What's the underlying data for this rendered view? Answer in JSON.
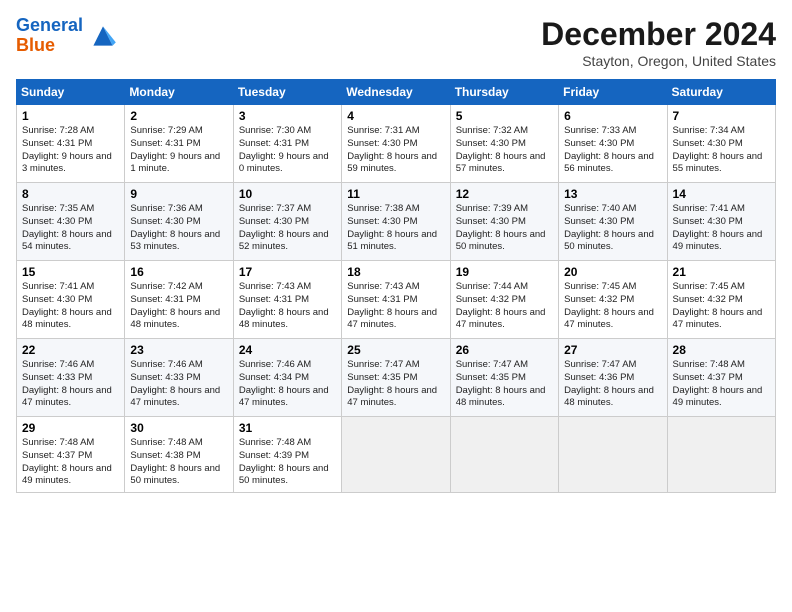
{
  "header": {
    "logo_line1": "General",
    "logo_line2": "Blue",
    "month": "December 2024",
    "location": "Stayton, Oregon, United States"
  },
  "weekdays": [
    "Sunday",
    "Monday",
    "Tuesday",
    "Wednesday",
    "Thursday",
    "Friday",
    "Saturday"
  ],
  "weeks": [
    [
      {
        "day": "1",
        "sunrise": "Sunrise: 7:28 AM",
        "sunset": "Sunset: 4:31 PM",
        "daylight": "Daylight: 9 hours and 3 minutes."
      },
      {
        "day": "2",
        "sunrise": "Sunrise: 7:29 AM",
        "sunset": "Sunset: 4:31 PM",
        "daylight": "Daylight: 9 hours and 1 minute."
      },
      {
        "day": "3",
        "sunrise": "Sunrise: 7:30 AM",
        "sunset": "Sunset: 4:31 PM",
        "daylight": "Daylight: 9 hours and 0 minutes."
      },
      {
        "day": "4",
        "sunrise": "Sunrise: 7:31 AM",
        "sunset": "Sunset: 4:30 PM",
        "daylight": "Daylight: 8 hours and 59 minutes."
      },
      {
        "day": "5",
        "sunrise": "Sunrise: 7:32 AM",
        "sunset": "Sunset: 4:30 PM",
        "daylight": "Daylight: 8 hours and 57 minutes."
      },
      {
        "day": "6",
        "sunrise": "Sunrise: 7:33 AM",
        "sunset": "Sunset: 4:30 PM",
        "daylight": "Daylight: 8 hours and 56 minutes."
      },
      {
        "day": "7",
        "sunrise": "Sunrise: 7:34 AM",
        "sunset": "Sunset: 4:30 PM",
        "daylight": "Daylight: 8 hours and 55 minutes."
      }
    ],
    [
      {
        "day": "8",
        "sunrise": "Sunrise: 7:35 AM",
        "sunset": "Sunset: 4:30 PM",
        "daylight": "Daylight: 8 hours and 54 minutes."
      },
      {
        "day": "9",
        "sunrise": "Sunrise: 7:36 AM",
        "sunset": "Sunset: 4:30 PM",
        "daylight": "Daylight: 8 hours and 53 minutes."
      },
      {
        "day": "10",
        "sunrise": "Sunrise: 7:37 AM",
        "sunset": "Sunset: 4:30 PM",
        "daylight": "Daylight: 8 hours and 52 minutes."
      },
      {
        "day": "11",
        "sunrise": "Sunrise: 7:38 AM",
        "sunset": "Sunset: 4:30 PM",
        "daylight": "Daylight: 8 hours and 51 minutes."
      },
      {
        "day": "12",
        "sunrise": "Sunrise: 7:39 AM",
        "sunset": "Sunset: 4:30 PM",
        "daylight": "Daylight: 8 hours and 50 minutes."
      },
      {
        "day": "13",
        "sunrise": "Sunrise: 7:40 AM",
        "sunset": "Sunset: 4:30 PM",
        "daylight": "Daylight: 8 hours and 50 minutes."
      },
      {
        "day": "14",
        "sunrise": "Sunrise: 7:41 AM",
        "sunset": "Sunset: 4:30 PM",
        "daylight": "Daylight: 8 hours and 49 minutes."
      }
    ],
    [
      {
        "day": "15",
        "sunrise": "Sunrise: 7:41 AM",
        "sunset": "Sunset: 4:30 PM",
        "daylight": "Daylight: 8 hours and 48 minutes."
      },
      {
        "day": "16",
        "sunrise": "Sunrise: 7:42 AM",
        "sunset": "Sunset: 4:31 PM",
        "daylight": "Daylight: 8 hours and 48 minutes."
      },
      {
        "day": "17",
        "sunrise": "Sunrise: 7:43 AM",
        "sunset": "Sunset: 4:31 PM",
        "daylight": "Daylight: 8 hours and 48 minutes."
      },
      {
        "day": "18",
        "sunrise": "Sunrise: 7:43 AM",
        "sunset": "Sunset: 4:31 PM",
        "daylight": "Daylight: 8 hours and 47 minutes."
      },
      {
        "day": "19",
        "sunrise": "Sunrise: 7:44 AM",
        "sunset": "Sunset: 4:32 PM",
        "daylight": "Daylight: 8 hours and 47 minutes."
      },
      {
        "day": "20",
        "sunrise": "Sunrise: 7:45 AM",
        "sunset": "Sunset: 4:32 PM",
        "daylight": "Daylight: 8 hours and 47 minutes."
      },
      {
        "day": "21",
        "sunrise": "Sunrise: 7:45 AM",
        "sunset": "Sunset: 4:32 PM",
        "daylight": "Daylight: 8 hours and 47 minutes."
      }
    ],
    [
      {
        "day": "22",
        "sunrise": "Sunrise: 7:46 AM",
        "sunset": "Sunset: 4:33 PM",
        "daylight": "Daylight: 8 hours and 47 minutes."
      },
      {
        "day": "23",
        "sunrise": "Sunrise: 7:46 AM",
        "sunset": "Sunset: 4:33 PM",
        "daylight": "Daylight: 8 hours and 47 minutes."
      },
      {
        "day": "24",
        "sunrise": "Sunrise: 7:46 AM",
        "sunset": "Sunset: 4:34 PM",
        "daylight": "Daylight: 8 hours and 47 minutes."
      },
      {
        "day": "25",
        "sunrise": "Sunrise: 7:47 AM",
        "sunset": "Sunset: 4:35 PM",
        "daylight": "Daylight: 8 hours and 47 minutes."
      },
      {
        "day": "26",
        "sunrise": "Sunrise: 7:47 AM",
        "sunset": "Sunset: 4:35 PM",
        "daylight": "Daylight: 8 hours and 48 minutes."
      },
      {
        "day": "27",
        "sunrise": "Sunrise: 7:47 AM",
        "sunset": "Sunset: 4:36 PM",
        "daylight": "Daylight: 8 hours and 48 minutes."
      },
      {
        "day": "28",
        "sunrise": "Sunrise: 7:48 AM",
        "sunset": "Sunset: 4:37 PM",
        "daylight": "Daylight: 8 hours and 49 minutes."
      }
    ],
    [
      {
        "day": "29",
        "sunrise": "Sunrise: 7:48 AM",
        "sunset": "Sunset: 4:37 PM",
        "daylight": "Daylight: 8 hours and 49 minutes."
      },
      {
        "day": "30",
        "sunrise": "Sunrise: 7:48 AM",
        "sunset": "Sunset: 4:38 PM",
        "daylight": "Daylight: 8 hours and 50 minutes."
      },
      {
        "day": "31",
        "sunrise": "Sunrise: 7:48 AM",
        "sunset": "Sunset: 4:39 PM",
        "daylight": "Daylight: 8 hours and 50 minutes."
      },
      null,
      null,
      null,
      null
    ]
  ]
}
